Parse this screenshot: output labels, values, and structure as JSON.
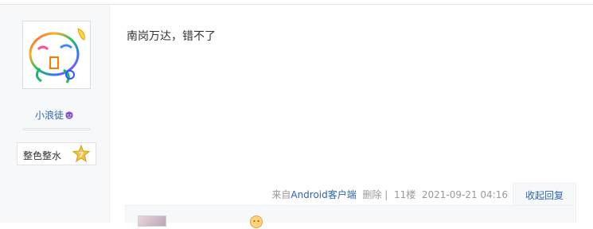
{
  "user": {
    "name": "小浪徒",
    "badge_icon": "devil-emoji-icon",
    "level_name": "整色整水",
    "level_number": "7"
  },
  "post": {
    "content": "南岗万达，错不了",
    "source_prefix": "来自",
    "source_client": "Android客户端",
    "delete_label": "删除",
    "separator": "|",
    "floor": "11楼",
    "timestamp": "2021-09-21 04:16",
    "reply_toggle_label": "收起回复"
  },
  "colors": {
    "link_blue": "#2d64b3",
    "meta_gray": "#999999",
    "sidebar_bg": "#f7f8fa"
  }
}
